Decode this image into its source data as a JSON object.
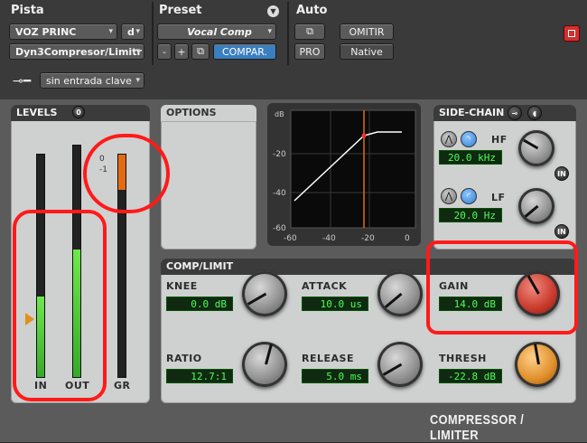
{
  "header": {
    "track_label": "Pista",
    "preset_label": "Preset",
    "auto_label": "Auto",
    "track_name": "VOZ PRINC",
    "track_channel": "d",
    "insert_name": "Dyn3Compresor/Limitr",
    "preset_name": "Vocal Comp",
    "minus_label": "-",
    "plus_label": "+",
    "compare_label": "COMPAR.",
    "pro_label": "PRO",
    "bypass_label": "OMITIR",
    "native_label": "Native",
    "key_input": "sin entrada clave"
  },
  "levels": {
    "title": "LEVELS",
    "in_label": "IN",
    "out_label": "OUT",
    "gr_label": "GR",
    "gr_ticks": [
      "0",
      "-1"
    ],
    "in_level": 0.36,
    "out_level": 0.55,
    "gr_level": 0.16
  },
  "options": {
    "title": "OPTIONS"
  },
  "graph": {
    "y_ticks": [
      "dB",
      "-20",
      "-40",
      "-60"
    ],
    "x_ticks": [
      "-60",
      "-40",
      "-20",
      "0"
    ]
  },
  "sidechain": {
    "title": "SIDE-CHAIN",
    "hf_label": "HF",
    "hf_value": "20.0 kHz",
    "lf_label": "LF",
    "lf_value": "20.0 Hz",
    "in_label": "IN"
  },
  "comp": {
    "title": "COMP/LIMIT",
    "knee_label": "KNEE",
    "knee_value": "0.0 dB",
    "attack_label": "ATTACK",
    "attack_value": "10.0 us",
    "gain_label": "GAIN",
    "gain_value": "14.0 dB",
    "ratio_label": "RATIO",
    "ratio_value": "12.7:1",
    "release_label": "RELEASE",
    "release_value": "5.0 ms",
    "thresh_label": "THRESH",
    "thresh_value": "-22.8 dB"
  },
  "brand": "COMPRESSOR / LIMITER",
  "colors": {
    "accent_blue": "#3a7fc0",
    "lcd_green": "#4cff5a",
    "gr_orange": "#e36b15",
    "annotation_red": "#ff1a1a"
  }
}
